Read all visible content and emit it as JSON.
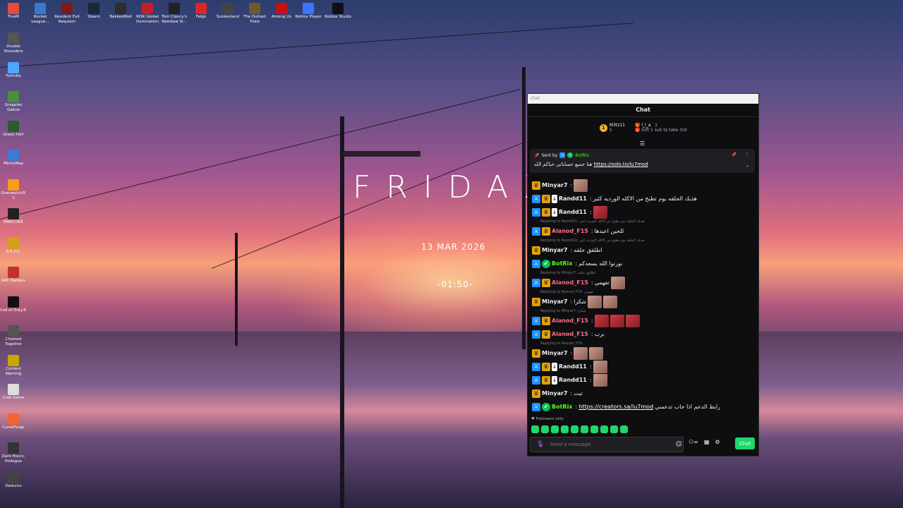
{
  "desktop": {
    "icons": [
      {
        "label": "FiveM",
        "color": "#e64c3c"
      },
      {
        "label": "Rocket League...",
        "color": "#3b78c8"
      },
      {
        "label": "Resident Evil Requiem",
        "color": "#7a1c1c"
      },
      {
        "label": "Steam",
        "color": "#1b2838"
      },
      {
        "label": "BakkesMod",
        "color": "#2d2d2d"
      },
      {
        "label": "RISK Global Domination",
        "color": "#c21f2b"
      },
      {
        "label": "Tom Clancy's Rainbow Si...",
        "color": "#222"
      },
      {
        "label": "Feign",
        "color": "#d62828"
      },
      {
        "label": "Sunkenland",
        "color": "#444"
      },
      {
        "label": "The Outlast Trials",
        "color": "#6b5a2a"
      },
      {
        "label": "Among Us",
        "color": "#c51111"
      },
      {
        "label": "Roblox Player",
        "color": "#3c73ff"
      },
      {
        "label": "Roblox Studio",
        "color": "#111"
      },
      {
        "label": "Double Shoulders",
        "color": "#555"
      },
      {
        "label": "Fortnite",
        "color": "#4aa8ff"
      },
      {
        "label": "Grapples Galore",
        "color": "#4a8f3a"
      },
      {
        "label": "Green Hell",
        "color": "#2b5b2b"
      },
      {
        "label": "MinnyMap",
        "color": "#3a7bd5"
      },
      {
        "label": "Overwatch® 2",
        "color": "#f99e1a"
      },
      {
        "label": "PANICORE",
        "color": "#222"
      },
      {
        "label": "R.E.P.O.",
        "color": "#d4a017"
      },
      {
        "label": "ARC Raiders",
        "color": "#c03030"
      },
      {
        "label": "Call of Duty®",
        "color": "#111"
      },
      {
        "label": "Chained Together",
        "color": "#555"
      },
      {
        "label": "Content Warning",
        "color": "#c8a800"
      },
      {
        "label": "Crab Game",
        "color": "#ddd"
      },
      {
        "label": "CurseForge",
        "color": "#f16436"
      },
      {
        "label": "Dark Hours: Prologue",
        "color": "#333"
      },
      {
        "label": "Deducto",
        "color": "#444"
      }
    ]
  },
  "clock": {
    "text": "FRIDAX",
    "date": "13 MAR 2026",
    "time": "-01:50-"
  },
  "chat": {
    "titlebar": "chat",
    "header": "Chat",
    "leaderboard": [
      {
        "rank": "1",
        "name": "M3tz11",
        "value": "5"
      },
      {
        "name": "l_l_a",
        "value": "1",
        "note": "Gift 1 sub to take 3rd"
      }
    ],
    "pinned": {
      "sent_by_label": "Sent by",
      "sender": "BotRix",
      "text": "هنا جميع حساباتي حياكم الله",
      "link": "https://solo.to/lu7mod"
    },
    "messages": [
      {
        "type": "msg",
        "badges": [
          "crown"
        ],
        "name": "Minyar7",
        "color": "#efeff1",
        "text": "",
        "emotes": 1
      },
      {
        "type": "msg",
        "badges": [
          "sword",
          "crown",
          "sub"
        ],
        "name": "Randd11",
        "color": "#efeff1",
        "text": "هذيك الحلقه يوم تطبخ من الاكله الورديه كثير",
        "emotes": 0
      },
      {
        "type": "msg",
        "badges": [
          "sword",
          "crown",
          "sub"
        ],
        "name": "Randd11",
        "color": "#efeff1",
        "text": "",
        "emotes": 1,
        "red": true
      },
      {
        "type": "reply",
        "text": "Replying to Randd11: هذيك الحلقه يوم تطبخ من الاكله الورديه كثير"
      },
      {
        "type": "msg",
        "badges": [
          "sword",
          "crown"
        ],
        "name": "Alanod_F15",
        "color": "#ff6b8a",
        "text": "للحين اعيدها",
        "emotes": 0
      },
      {
        "type": "reply",
        "text": "Replying to Randd11: هذيك الحلقه يوم تطبخ من الاكله الورديه كثير"
      },
      {
        "type": "msg",
        "badges": [
          "crown"
        ],
        "name": "Minyar7",
        "color": "#efeff1",
        "text": "اطلقق حلقه",
        "emotes": 0
      },
      {
        "type": "msg",
        "badges": [
          "sword",
          "verified"
        ],
        "name": "BotRix",
        "color": "#53fc18",
        "text": "نورتوا الله يسعدكم",
        "emotes": 0
      },
      {
        "type": "reply",
        "text": "Replying to Minyar7: اطلقق حلقه"
      },
      {
        "type": "msg",
        "badges": [
          "sword",
          "crown"
        ],
        "name": "Alanod_F15",
        "color": "#ff6b8a",
        "text": "تفهمي",
        "emotes": 1
      },
      {
        "type": "reply",
        "text": "Replying to Alanod_F15: تفهمي"
      },
      {
        "type": "msg",
        "badges": [
          "crown"
        ],
        "name": "Minyar7",
        "color": "#efeff1",
        "text": "شكرا",
        "emotes": 2
      },
      {
        "type": "reply",
        "text": "Replying to Minyar7: شكرا"
      },
      {
        "type": "msg",
        "badges": [
          "sword",
          "crown"
        ],
        "name": "Alanod_F15",
        "color": "#ff6b8a",
        "text": "",
        "emotes": 3,
        "red": true
      },
      {
        "type": "msg",
        "badges": [
          "sword",
          "crown"
        ],
        "name": "Alanod_F15",
        "color": "#ff6b8a",
        "text": "برب",
        "emotes": 0
      },
      {
        "type": "reply",
        "text": "Replying to Alanod_F15:"
      },
      {
        "type": "msg",
        "badges": [
          "crown"
        ],
        "name": "Minyar7",
        "color": "#efeff1",
        "text": "",
        "emotes": 2
      },
      {
        "type": "msg",
        "badges": [
          "sword",
          "crown",
          "sub"
        ],
        "name": "Randd11",
        "color": "#efeff1",
        "text": "",
        "emotes": 1
      },
      {
        "type": "msg",
        "badges": [
          "sword",
          "crown",
          "sub"
        ],
        "name": "Randd11",
        "color": "#efeff1",
        "text": "",
        "emotes": 1
      },
      {
        "type": "msg",
        "badges": [
          "crown"
        ],
        "name": "Minyar7",
        "color": "#efeff1",
        "text": "ثبت",
        "emotes": 0
      },
      {
        "type": "msg",
        "badges": [
          "sword",
          "verified"
        ],
        "name": "BotRix",
        "color": "#53fc18",
        "text": "رابط الدعم اذا حاب تدعمني",
        "link": "https://creators.sa/lu7mod",
        "emotes": 0
      }
    ],
    "followers_only": "Followers only",
    "input_placeholder": "Send a message",
    "send_label": "Chat"
  }
}
